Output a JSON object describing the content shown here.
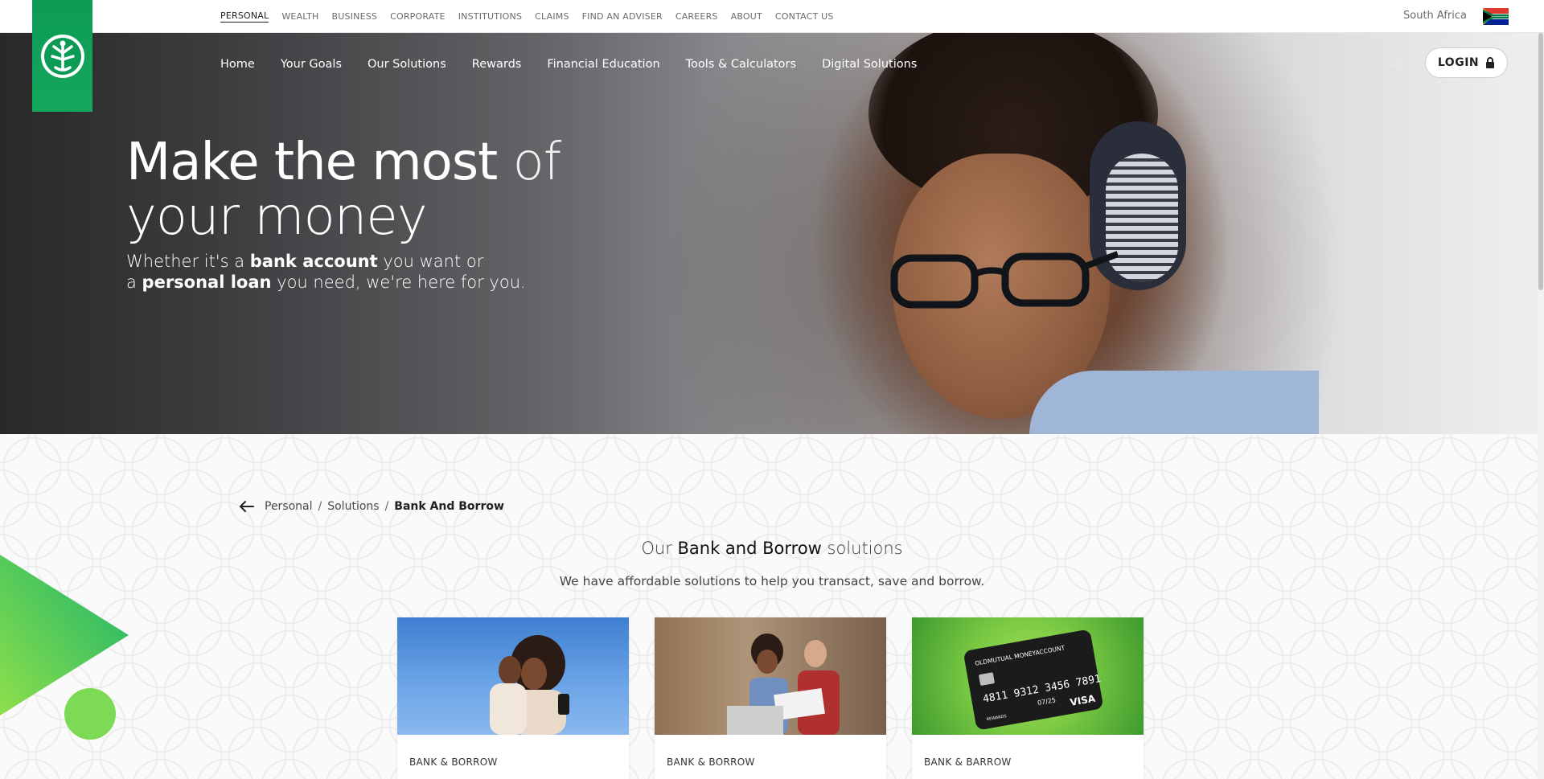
{
  "topbar": {
    "links": [
      {
        "label": "PERSONAL",
        "active": true
      },
      {
        "label": "WEALTH"
      },
      {
        "label": "BUSINESS"
      },
      {
        "label": "CORPORATE"
      },
      {
        "label": "INSTITUTIONS"
      },
      {
        "label": "CLAIMS"
      },
      {
        "label": "FIND AN ADVISER"
      },
      {
        "label": "CAREERS"
      },
      {
        "label": "ABOUT"
      },
      {
        "label": "CONTACT US"
      }
    ],
    "region": "South Africa",
    "flag_icon": "south-africa-flag-icon"
  },
  "logo": {
    "icon": "old-mutual-tree-icon",
    "color": "#0c9b54"
  },
  "mainnav": {
    "items": [
      "Home",
      "Your Goals",
      "Our Solutions",
      "Rewards",
      "Financial Education",
      "Tools & Calculators",
      "Digital Solutions"
    ],
    "search_icon": "search-icon",
    "login_label": "LOGIN",
    "login_icon": "lock-icon"
  },
  "hero": {
    "title_part1": "Make the most",
    "title_part2": " of",
    "title_line2": "your money",
    "sub_1a": "Whether it's a ",
    "sub_1b": "bank account",
    "sub_1c": " you want or",
    "sub_2a": "a ",
    "sub_2b": "personal loan",
    "sub_2c": " you need, we're here for you."
  },
  "breadcrumb": {
    "back_icon": "arrow-left-icon",
    "items": [
      "Personal",
      "Solutions"
    ],
    "current": "Bank And Borrow"
  },
  "section": {
    "title_pre": "Our ",
    "title_bold": "Bank and Borrow",
    "title_post": " solutions",
    "description": "We have affordable solutions to help you transact, save and borrow."
  },
  "cards": [
    {
      "label": "BANK & BORROW"
    },
    {
      "label": "BANK & BORROW"
    },
    {
      "label": "BANK & BARROW",
      "card_text": {
        "brand": "OLDMUTUAL MONEYACCOUNT",
        "number": "4811 9312 3456 7891",
        "expiry": "07/25",
        "network": "VISA",
        "rewards": "REWARDS"
      }
    }
  ],
  "colors": {
    "brand_green": "#0c9b54",
    "accent_light_green": "#7ed957"
  }
}
